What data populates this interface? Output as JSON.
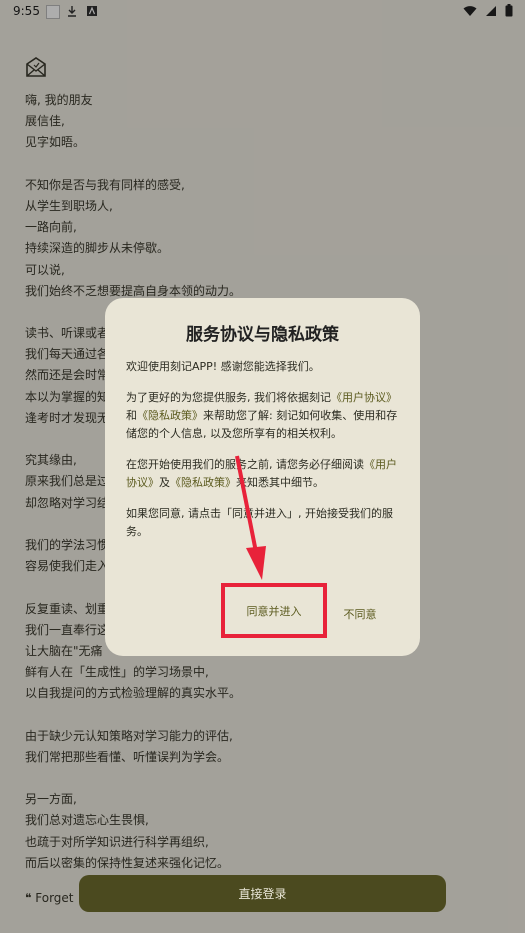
{
  "status_bar": {
    "time": "9:55"
  },
  "letter": {
    "lines": [
      "嗨, 我的朋友",
      "展信佳,",
      "见字如晤。",
      "",
      "不知你是否与我有同样的感受,",
      "从学生到职场人,",
      "一路向前,",
      "持续深造的脚步从未停歇。",
      "可以说,",
      "我们始终不乏想要提高自身本领的动力。",
      "",
      "读书、听课或者",
      "我们每天通过各",
      "然而还是会时常",
      "本以为掌握的知",
      "逢考时才发现无",
      "",
      "究其缘由,",
      "原来我们总是过",
      "却忽略对学习结",
      "",
      "我们的学法习惯",
      "容易使我们走入",
      "",
      "反复重读、划重",
      "我们一直奉行这",
      "让大脑在\"无痛",
      "鲜有人在「生成性」的学习场景中,",
      "以自我提问的方式检验理解的真实水平。",
      "",
      "由于缺少元认知策略对学习能力的评估,",
      "我们常把那些看懂、听懂误判为学会。",
      "",
      "另一方面,",
      "我们总对遗忘心生畏惧,",
      "也疏于对所学知识进行科学再组织,",
      "而后以密集的保持性复述来强化记忆。"
    ],
    "quote": "❝  Forget"
  },
  "bottom_button": {
    "label": "直接登录"
  },
  "dialog": {
    "title": "服务协议与隐私政策",
    "p1": "欢迎使用刻记APP! 感谢您能选择我们。",
    "p2_a": "为了更好的为您提供服务, 我们将依据刻记",
    "p2_link1": "《用户协议》",
    "p2_b": "和",
    "p2_link2": "《隐私政策》",
    "p2_c": "来帮助您了解: 刻记如何收集、使用和存储您的个人信息, 以及您所享有的相关权利。",
    "p3_a": "在您开始使用我们的服务之前, 请您务必仔细阅读",
    "p3_link1": "《用户协议》",
    "p3_b": "及",
    "p3_link2": "《隐私政策》",
    "p3_c": "来知悉其中细节。",
    "p4": "如果您同意, 请点击「同意并进入」, 开始接受我们的服务。",
    "agree_label": "同意并进入",
    "disagree_label": "不同意"
  },
  "colors": {
    "accent": "#5b5a1e",
    "highlight": "#e8223a",
    "button": "#4b4a1f"
  }
}
